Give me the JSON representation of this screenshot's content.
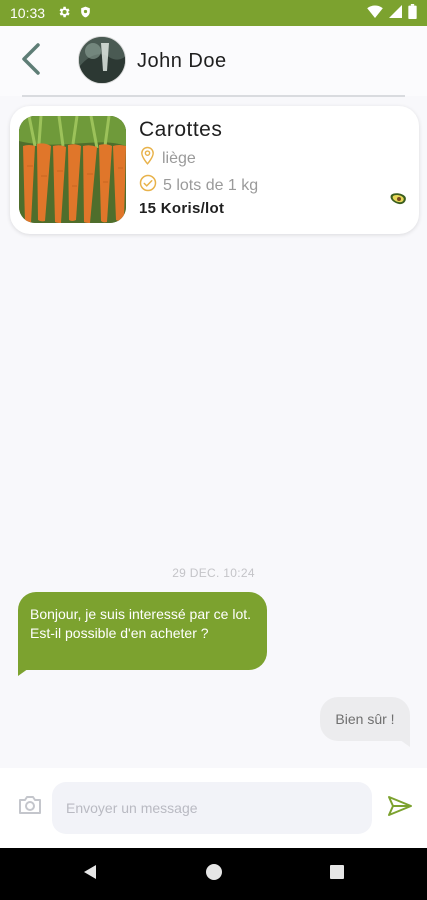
{
  "status_bar": {
    "time": "10:33",
    "icons": [
      "gear-icon",
      "shield-icon",
      "wifi-icon",
      "signal-icon",
      "battery-icon"
    ]
  },
  "header": {
    "back_icon": "chevron-left-icon",
    "contact_name": "John Doe"
  },
  "product": {
    "title": "Carottes",
    "location": "liège",
    "lots": "5 lots de 1 kg",
    "price": "15 Koris/lot",
    "icons": {
      "location": "map-pin-icon",
      "lots": "check-circle-icon",
      "badge": "avocado-icon"
    }
  },
  "conversation": {
    "date": "29 DEC. 10:24",
    "messages": [
      {
        "direction": "incoming",
        "text": "Bonjour, je suis interessé par ce lot. Est-il possible d'en acheter ?"
      },
      {
        "direction": "outgoing",
        "text": "Bien sûr !"
      }
    ]
  },
  "composer": {
    "placeholder": "Envoyer un message",
    "value": "",
    "camera_icon": "camera-icon",
    "send_icon": "send-icon"
  },
  "navigation": {
    "icons": [
      "nav-back-icon",
      "nav-home-icon",
      "nav-recents-icon"
    ]
  },
  "colors": {
    "accent": "#7ca22f",
    "incoming_bubble": "#7ca22f",
    "outgoing_bubble": "#ececee",
    "background": "#f8f8fb"
  }
}
